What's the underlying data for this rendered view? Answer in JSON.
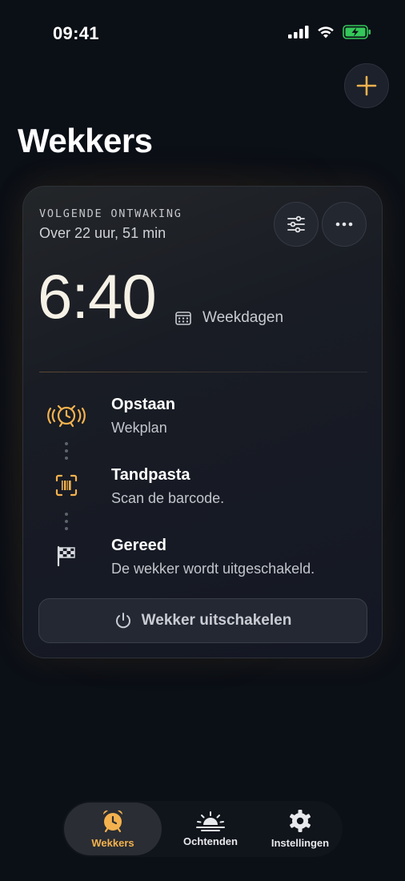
{
  "status": {
    "time": "09:41"
  },
  "header": {
    "title": "Wekkers"
  },
  "card": {
    "next_label": "VOLGENDE ONTWAKING",
    "next_time": "Over 22 uur, 51 min",
    "alarm_time": "6:40",
    "repeat": "Weekdagen",
    "steps": [
      {
        "title": "Opstaan",
        "subtitle": "Wekplan",
        "icon": "alarm-ringing-icon"
      },
      {
        "title": "Tandpasta",
        "subtitle": "Scan de barcode.",
        "icon": "barcode-scan-icon"
      },
      {
        "title": "Gereed",
        "subtitle": "De wekker wordt uitgeschakeld.",
        "icon": "checkered-flag-icon"
      }
    ],
    "disable_label": "Wekker uitschakelen"
  },
  "tabs": [
    {
      "label": "Wekkers",
      "icon": "alarm-clock-icon",
      "active": true
    },
    {
      "label": "Ochtenden",
      "icon": "sunrise-icon",
      "active": false
    },
    {
      "label": "Instellingen",
      "icon": "gear-icon",
      "active": false
    }
  ],
  "colors": {
    "accent": "#F4B24E",
    "background": "#0B0F16",
    "battery": "#34C759"
  }
}
